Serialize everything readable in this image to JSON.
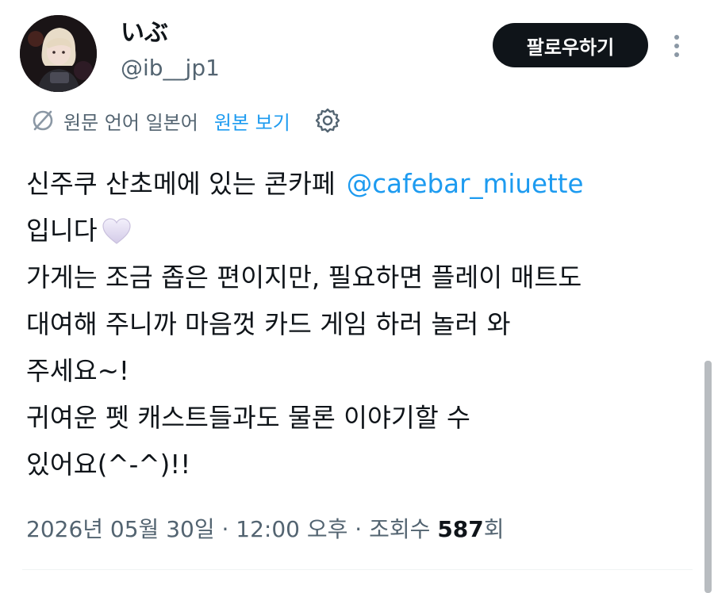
{
  "user": {
    "display_name": "いぶ",
    "handle": "@ib__jp1",
    "avatar_icon": "profile-photo"
  },
  "actions": {
    "follow_label": "팔로우하기",
    "more_icon": "more-vertical-icon"
  },
  "translation": {
    "icon": "translate-icon",
    "language_label": "원문 언어 일본어",
    "view_original_label": "원본 보기",
    "settings_icon": "gear-icon"
  },
  "tweet": {
    "lines": [
      "신주쿠 산초메에 있는 콘카페",
      "입니다",
      "가게는 조금 좁은 편이지만, 필요하면 플레이 매트도",
      "대여해 주니까 마음껏 카드 게임 하러 놀러 와",
      "주세요~!",
      "귀여운 펫 캐스트들과도 물론 이야기할 수",
      "있어요(^-^)!!"
    ],
    "mention": "@cafebar_miuette",
    "emoji": "white-heart-icon"
  },
  "meta": {
    "timestamp": "2026년 05월 30일 · 12:00 오후 · 조회수",
    "views": "587",
    "views_suffix": "회"
  },
  "colors": {
    "accent": "#1d9bf0",
    "text": "#0f1419",
    "secondary": "#536471",
    "button_bg": "#0f1419"
  }
}
